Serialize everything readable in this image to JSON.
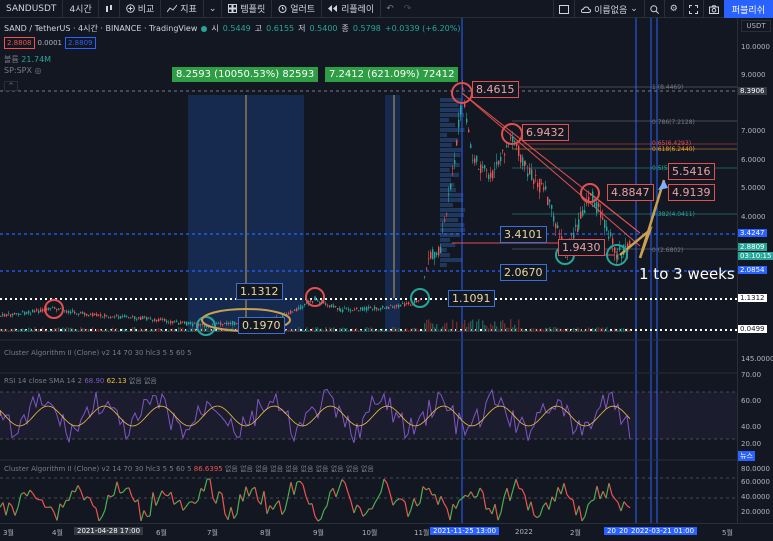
{
  "toolbar": {
    "symbol": "SANDUSDT",
    "interval": "4시간",
    "compare_label": "비교",
    "indicators_label": "지표",
    "templates_label": "템플릿",
    "alert_label": "얼러트",
    "replay_label": "리플레이",
    "layout_name": "이름없음",
    "publish_label": "퍼블리쉬"
  },
  "legend": {
    "title": "SAND / TetherUS · 4시간 · BINANCE · TradingView",
    "open_label": "시",
    "open": "0.5449",
    "high_label": "고",
    "high": "0.6155",
    "low_label": "저",
    "low": "0.5400",
    "close_label": "종",
    "close": "0.5798",
    "change": "+0.0339 (+6.20%)",
    "sell_price": "2.8808",
    "spread": "0.0001",
    "buy_price": "2.8809",
    "volume_label": "볼륨",
    "volume_value": "21.74M",
    "index_label": "SP:SPX"
  },
  "annotations": {
    "green_box_1": "8.2593 (10050.53%) 82593",
    "green_box_2": "7.2412 (621.09%) 72412",
    "peak": "8.4615",
    "second_top": "6.9432",
    "third_top": "4.8847",
    "target_high": "5.5416",
    "target_mid": "4.9139",
    "mid_level": "3.4101",
    "low_level": "1.9430",
    "support": "2.0670",
    "breakout": "1.1091",
    "range_top": "1.1312",
    "range_bottom": "0.1970",
    "forecast_text": "1 to 3 weeks"
  },
  "fib_labels": {
    "f1": "1 (8.4469)",
    "f2": "0.786(7.2128)",
    "f3": "0.618(6.2440)",
    "f4": "0.65(6.4293)",
    "f5": "0.5(5.5...)",
    "f6": "0.382(4.0411)",
    "f7": "0 (2.6802)"
  },
  "panes": {
    "cluster1": "Cluster Algorithm II (Clone) v2 14 70 30 hlc3 5 5 60 5",
    "rsi": "RSI 14 close SMA 14 2",
    "rsi_val1": "68.90",
    "rsi_val2": "62.13",
    "rsi_na": "없음 없음",
    "cluster2": "Cluster Algorithm II (Clone) v2 14 70 30 hlc3 5 5 60 5",
    "cluster2_val": "86.6395",
    "cluster2_na": "없음 없음 없음 없음 없음 없음 없음 없음 없음 없음"
  },
  "price_axis": {
    "currency": "USDT",
    "ticks": [
      "10.0000",
      "9.0000",
      "8.0000",
      "7.0000",
      "6.0000",
      "5.0000",
      "4.0000",
      "3.0000",
      "2.0000",
      "1.0000",
      "0.0000"
    ],
    "tag_top": "8.3906",
    "tag_mid": "3.4247",
    "tag_price": "2.8809",
    "tag_countdown": "03:10:15",
    "tag_low": "2.0854",
    "tag_range": "1.1312",
    "tag_bottom": "0.0499",
    "cluster_ticks": [
      "145.0000",
      "0.0000"
    ],
    "rsi_ticks": [
      "70.00",
      "60.00",
      "40.00",
      "20.00"
    ],
    "cluster2_tags": [
      "뉴스",
      "80.0000",
      "60.0000",
      "40.0000",
      "20.0000"
    ]
  },
  "time_axis": {
    "labels": [
      "3월",
      "4월",
      "6월",
      "7월",
      "8월",
      "9월",
      "10월",
      "11월",
      "2022",
      "2월",
      "5월"
    ],
    "tag_1": "2021-04-28  17:00",
    "tag_2": "2021-11-25  13:00",
    "tag_3": "20",
    "tag_4": "20",
    "tag_5": "2022-03-21  01:00"
  },
  "colors": {
    "background": "#131722",
    "up": "#26a69a",
    "down": "#ef5350",
    "accent": "#2962ff",
    "annotation_green": "#2e9e44"
  }
}
